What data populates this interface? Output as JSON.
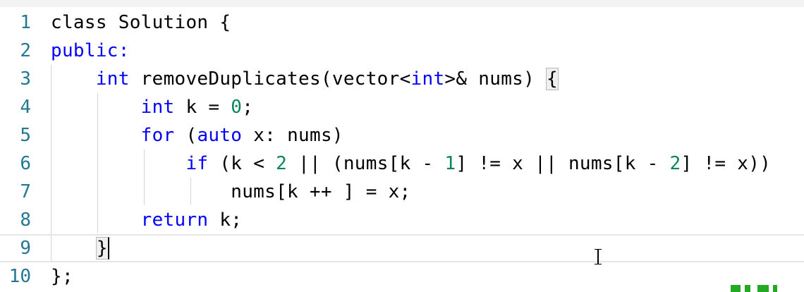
{
  "editor": {
    "lines": [
      {
        "number": "1",
        "segments": [
          {
            "t": "class",
            "c": "plain"
          },
          {
            "t": " Solution {",
            "c": "plain"
          }
        ]
      },
      {
        "number": "2",
        "segments": [
          {
            "t": "public:",
            "c": "kw"
          }
        ]
      },
      {
        "number": "3",
        "segments": [
          {
            "t": "    ",
            "c": "plain"
          },
          {
            "t": "int",
            "c": "kw"
          },
          {
            "t": " removeDuplicates(vector<",
            "c": "plain"
          },
          {
            "t": "int",
            "c": "kw"
          },
          {
            "t": ">& nums) ",
            "c": "plain"
          },
          {
            "t": "{",
            "c": "bracket"
          }
        ]
      },
      {
        "number": "4",
        "segments": [
          {
            "t": "        ",
            "c": "plain"
          },
          {
            "t": "int",
            "c": "kw"
          },
          {
            "t": " k = ",
            "c": "plain"
          },
          {
            "t": "0",
            "c": "num"
          },
          {
            "t": ";",
            "c": "plain"
          }
        ]
      },
      {
        "number": "5",
        "segments": [
          {
            "t": "        ",
            "c": "plain"
          },
          {
            "t": "for",
            "c": "kw"
          },
          {
            "t": " (",
            "c": "plain"
          },
          {
            "t": "auto",
            "c": "kw"
          },
          {
            "t": " x: nums)",
            "c": "plain"
          }
        ]
      },
      {
        "number": "6",
        "segments": [
          {
            "t": "            ",
            "c": "plain"
          },
          {
            "t": "if",
            "c": "kw"
          },
          {
            "t": " (k < ",
            "c": "plain"
          },
          {
            "t": "2",
            "c": "num"
          },
          {
            "t": " || (nums[k - ",
            "c": "plain"
          },
          {
            "t": "1",
            "c": "num"
          },
          {
            "t": "] != x || nums[k - ",
            "c": "plain"
          },
          {
            "t": "2",
            "c": "num"
          },
          {
            "t": "] != x))",
            "c": "plain"
          }
        ]
      },
      {
        "number": "7",
        "segments": [
          {
            "t": "                nums[k ++ ] = x;",
            "c": "plain"
          }
        ]
      },
      {
        "number": "8",
        "segments": [
          {
            "t": "        ",
            "c": "plain"
          },
          {
            "t": "return",
            "c": "kw"
          },
          {
            "t": " k;",
            "c": "plain"
          }
        ]
      },
      {
        "number": "9",
        "segments": [
          {
            "t": "    ",
            "c": "plain"
          },
          {
            "t": "}",
            "c": "cursorbracket"
          }
        ]
      },
      {
        "number": "10",
        "segments": [
          {
            "t": "};",
            "c": "plain"
          }
        ]
      }
    ],
    "current_line": "9",
    "colors": {
      "keyword": "#0000ff",
      "number": "#098658",
      "line_number": "#237893",
      "text": "#000000",
      "watermark": "#22aa22"
    },
    "icons": {
      "mouse_cursor": "text-ibeam-icon"
    }
  }
}
